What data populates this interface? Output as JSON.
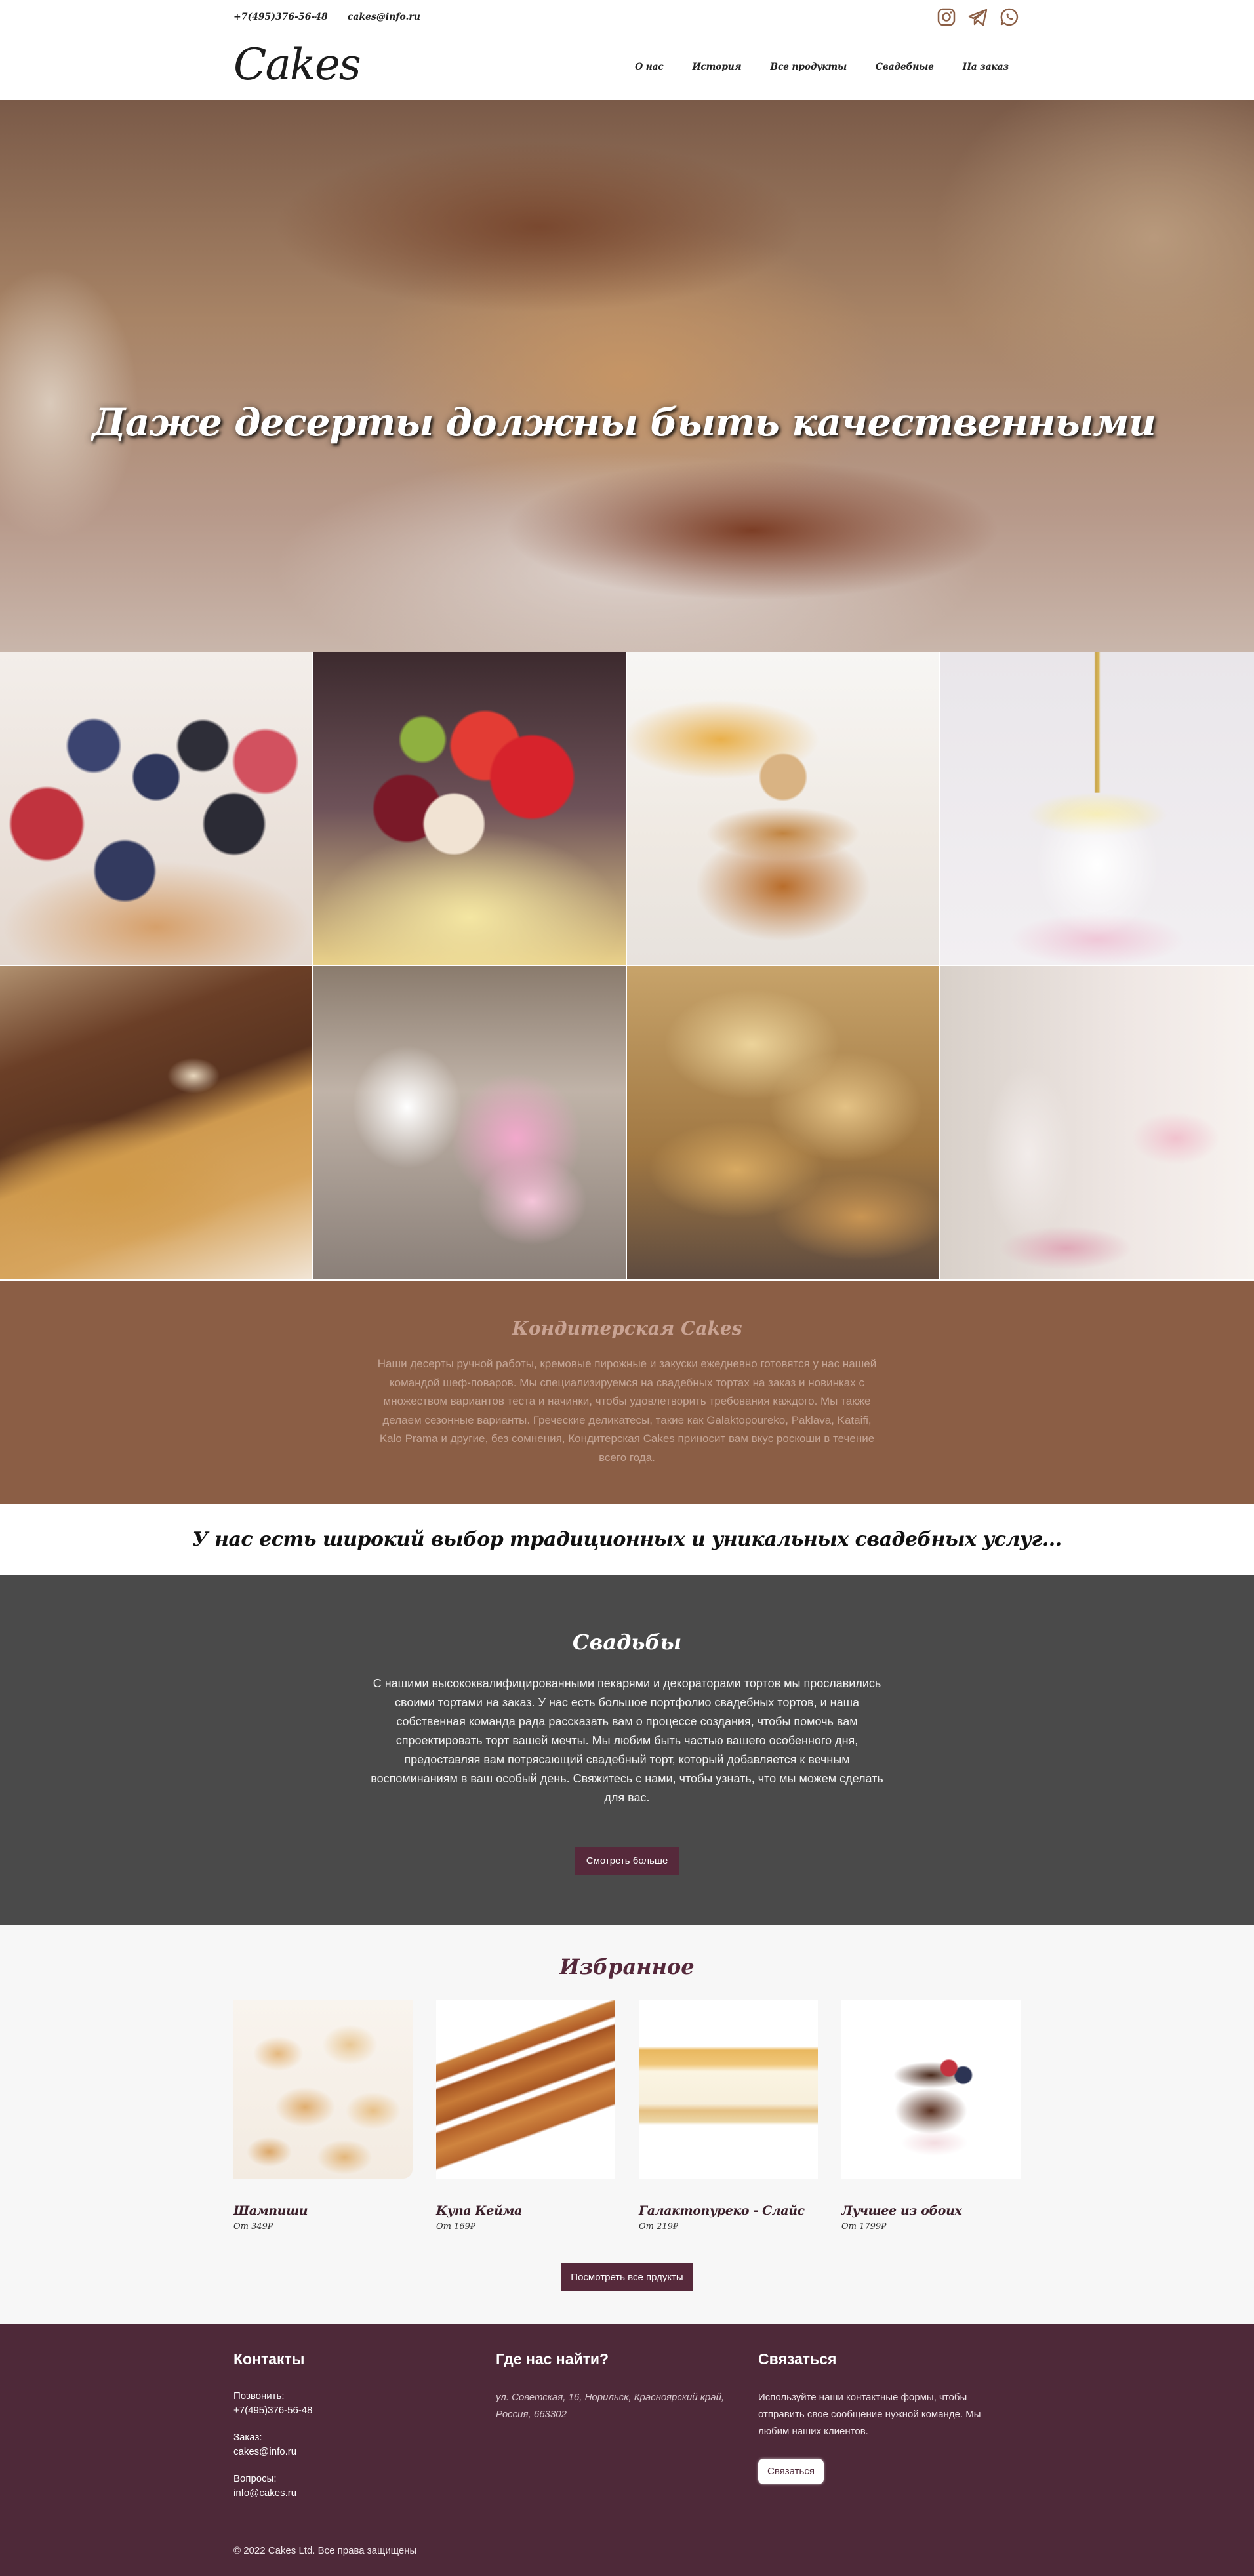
{
  "topbar": {
    "phone": "+7(495)376-56-48",
    "email": "cakes@info.ru",
    "social_icons": [
      "instagram-icon",
      "telegram-icon",
      "whatsapp-icon"
    ],
    "icon_color": "#8b5e45"
  },
  "navbar": {
    "logo": "Cakes",
    "links": [
      "О нас",
      "История",
      "Все продукты",
      "Свадебные",
      "На заказ"
    ]
  },
  "hero": {
    "title": "Даже десерты должны быть качественными"
  },
  "about": {
    "title": "Кондитерская Cakes",
    "text": "Наши десерты ручной работы, кремовые пирожные и закуски ежедневно готовятся у нас нашей командой шеф-поваров. Мы специализируемся на свадебных тортах на заказ и новинках с множеством вариантов теста и начинки, чтобы удовлетворить требования каждого. Мы также делаем сезонные варианты. Греческие деликатесы, такие как Galaktopoureko, Paklava, Kataifi, Kalo Prama и другие, без сомнения, Кондитерская Cakes приносит вам вкус роскоши в течение всего года.",
    "bg_color": "#8b5e45"
  },
  "tagline": "У нас есть широкий выбор традиционных и уникальных свадебных услуг...",
  "weddings": {
    "title": "Свадьбы",
    "text": "С нашими высококвалифицированными пекарями и декораторами тортов мы прославились своими тортами на заказ. У нас есть большое портфолио свадебных тортов, и наша собственная команда рада рассказать вам о процессе создания, чтобы помочь вам спроектировать торт вашей мечты. Мы любим быть частью вашего особенного дня, предоставляя вам потрясающий свадебный торт, который добавляется к вечным воспоминаниям в ваш особый день. Свяжитесь с нами, чтобы узнать, что мы можем сделать для вас.",
    "button": "Смотреть больше",
    "bg_color": "#4a4a4a"
  },
  "featured": {
    "title": "Избранное",
    "products": [
      {
        "name": "Шампиши",
        "price": "От 349₽"
      },
      {
        "name": "Купа Кейма",
        "price": "От 169₽"
      },
      {
        "name": "Галактопуреко - Слайс",
        "price": "От 219₽"
      },
      {
        "name": "Лучшее из обоих",
        "price": "От 1799₽"
      }
    ],
    "button": "Посмотреть все прдукты"
  },
  "footer": {
    "contacts": {
      "title": "Контакты",
      "call_label": "Позвонить:",
      "call_value": "+7(495)376-56-48",
      "order_label": "Заказ:",
      "order_value": "cakes@info.ru",
      "questions_label": "Вопросы:",
      "questions_value": "info@cakes.ru"
    },
    "location": {
      "title": "Где нас найти?",
      "address": "ул. Советская, 16, Норильск, Красноярский край, Россия, 663302"
    },
    "connect": {
      "title": "Связаться",
      "text": "Используйте наши контактные формы, чтобы отправить свое сообщение нужной команде. Мы любим наших клиентов.",
      "button": "Связаться"
    },
    "copyright": "© 2022 Cakes Ltd. Все права защищены",
    "bg_color": "#4e2939"
  }
}
